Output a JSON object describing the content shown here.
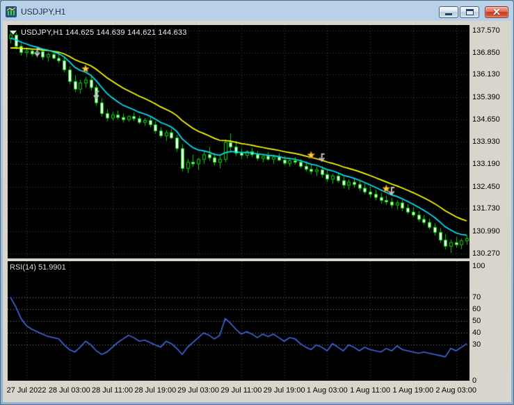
{
  "window": {
    "title": "USDJPY,H1"
  },
  "chart": {
    "info_line": "USDJPY,H1 144.625 144.639 144.621 144.633",
    "rsi_label": "RSI(14) 51.9901"
  },
  "chart_data": {
    "type": "candlestick",
    "title": "USDJPY,H1",
    "price_range": {
      "min": 130.1,
      "max": 137.75
    },
    "price_axis_labels": [
      {
        "text": "137.570",
        "value": 137.57
      },
      {
        "text": "136.850",
        "value": 136.85
      },
      {
        "text": "136.130",
        "value": 136.13
      },
      {
        "text": "135.390",
        "value": 135.39
      },
      {
        "text": "134.650",
        "value": 134.65
      },
      {
        "text": "133.930",
        "value": 133.93
      },
      {
        "text": "133.190",
        "value": 133.19
      },
      {
        "text": "132.450",
        "value": 132.45
      },
      {
        "text": "131.730",
        "value": 131.73
      },
      {
        "text": "130.990",
        "value": 130.99
      },
      {
        "text": "130.270",
        "value": 130.27
      }
    ],
    "time_labels": [
      {
        "text": "27 Jul 2022",
        "index": 3
      },
      {
        "text": "28 Jul 03:00",
        "index": 11
      },
      {
        "text": "28 Jul 11:00",
        "index": 19
      },
      {
        "text": "28 Jul 19:00",
        "index": 27
      },
      {
        "text": "29 Jul 03:00",
        "index": 35
      },
      {
        "text": "29 Jul 11:00",
        "index": 43
      },
      {
        "text": "29 Jul 19:00",
        "index": 51
      },
      {
        "text": "1 Aug 03:00",
        "index": 59
      },
      {
        "text": "1 Aug 11:00",
        "index": 67
      },
      {
        "text": "1 Aug 19:00",
        "index": 75
      },
      {
        "text": "2 Aug 03:00",
        "index": 83
      }
    ],
    "candles": [
      [
        137.3,
        137.57,
        137.15,
        137.42
      ],
      [
        137.42,
        137.5,
        136.95,
        137.05
      ],
      [
        137.05,
        137.15,
        136.75,
        136.85
      ],
      [
        136.85,
        137.0,
        136.7,
        136.9
      ],
      [
        136.9,
        136.98,
        136.72,
        136.8
      ],
      [
        136.8,
        136.92,
        136.68,
        136.88
      ],
      [
        136.88,
        136.95,
        136.6,
        136.7
      ],
      [
        136.7,
        136.85,
        136.55,
        136.78
      ],
      [
        136.78,
        136.88,
        136.62,
        136.66
      ],
      [
        136.66,
        136.8,
        136.5,
        136.58
      ],
      [
        136.58,
        136.7,
        136.2,
        136.28
      ],
      [
        136.28,
        136.4,
        135.8,
        135.9
      ],
      [
        135.9,
        136.1,
        135.55,
        135.65
      ],
      [
        135.65,
        135.95,
        135.5,
        135.85
      ],
      [
        135.85,
        136.05,
        135.7,
        135.95
      ],
      [
        135.95,
        136.1,
        135.6,
        135.7
      ],
      [
        135.7,
        135.8,
        135.1,
        135.2
      ],
      [
        135.2,
        135.35,
        134.75,
        134.85
      ],
      [
        134.85,
        135.0,
        134.6,
        134.7
      ],
      [
        134.7,
        134.9,
        134.62,
        134.8
      ],
      [
        134.8,
        134.95,
        134.65,
        134.72
      ],
      [
        134.72,
        134.85,
        134.55,
        134.65
      ],
      [
        134.65,
        134.8,
        134.58,
        134.75
      ],
      [
        134.75,
        134.88,
        134.6,
        134.68
      ],
      [
        134.68,
        134.78,
        134.5,
        134.56
      ],
      [
        134.56,
        134.7,
        134.45,
        134.62
      ],
      [
        134.62,
        134.72,
        134.4,
        134.48
      ],
      [
        134.48,
        134.6,
        134.2,
        134.28
      ],
      [
        134.28,
        134.4,
        134.05,
        134.12
      ],
      [
        134.12,
        134.3,
        133.95,
        134.22
      ],
      [
        134.22,
        134.35,
        134.0,
        134.05
      ],
      [
        134.05,
        134.15,
        133.6,
        133.7
      ],
      [
        133.7,
        133.85,
        132.95,
        133.05
      ],
      [
        133.05,
        133.35,
        132.9,
        133.25
      ],
      [
        133.25,
        133.5,
        133.1,
        133.2
      ],
      [
        133.2,
        133.4,
        133.0,
        133.35
      ],
      [
        133.35,
        133.6,
        133.2,
        133.5
      ],
      [
        133.5,
        133.75,
        133.3,
        133.4
      ],
      [
        133.4,
        133.55,
        133.15,
        133.25
      ],
      [
        133.25,
        133.45,
        133.05,
        133.35
      ],
      [
        133.35,
        134.0,
        133.25,
        133.9
      ],
      [
        133.9,
        134.2,
        133.6,
        133.75
      ],
      [
        133.75,
        133.95,
        133.45,
        133.55
      ],
      [
        133.55,
        133.7,
        133.35,
        133.48
      ],
      [
        133.48,
        133.65,
        133.38,
        133.6
      ],
      [
        133.6,
        133.72,
        133.42,
        133.5
      ],
      [
        133.5,
        133.62,
        133.3,
        133.38
      ],
      [
        133.38,
        133.52,
        133.25,
        133.45
      ],
      [
        133.45,
        133.58,
        133.3,
        133.35
      ],
      [
        133.35,
        133.5,
        133.2,
        133.42
      ],
      [
        133.42,
        133.55,
        133.28,
        133.32
      ],
      [
        133.32,
        133.45,
        133.15,
        133.22
      ],
      [
        133.22,
        133.38,
        133.1,
        133.3
      ],
      [
        133.3,
        133.42,
        133.18,
        133.25
      ],
      [
        133.25,
        133.35,
        133.05,
        133.12
      ],
      [
        133.12,
        133.28,
        132.95,
        133.02
      ],
      [
        133.02,
        133.18,
        132.85,
        132.95
      ],
      [
        132.95,
        133.1,
        132.8,
        133.0
      ],
      [
        133.0,
        133.12,
        132.75,
        132.85
      ],
      [
        132.85,
        132.98,
        132.6,
        132.7
      ],
      [
        132.7,
        132.88,
        132.55,
        132.8
      ],
      [
        132.8,
        132.92,
        132.58,
        132.65
      ],
      [
        132.65,
        132.78,
        132.4,
        132.5
      ],
      [
        132.5,
        132.68,
        132.35,
        132.6
      ],
      [
        132.6,
        132.72,
        132.42,
        132.52
      ],
      [
        132.52,
        132.65,
        132.3,
        132.4
      ],
      [
        132.4,
        132.55,
        132.2,
        132.28
      ],
      [
        132.28,
        132.45,
        132.1,
        132.2
      ],
      [
        132.2,
        132.35,
        132.0,
        132.1
      ],
      [
        132.1,
        132.25,
        131.9,
        132.0
      ],
      [
        132.0,
        132.15,
        131.85,
        131.95
      ],
      [
        131.95,
        132.08,
        131.75,
        131.85
      ],
      [
        131.85,
        132.0,
        131.7,
        131.92
      ],
      [
        131.92,
        132.02,
        131.65,
        131.75
      ],
      [
        131.75,
        131.88,
        131.55,
        131.62
      ],
      [
        131.62,
        131.78,
        131.45,
        131.52
      ],
      [
        131.52,
        131.65,
        131.3,
        131.38
      ],
      [
        131.38,
        131.52,
        131.2,
        131.28
      ],
      [
        131.28,
        131.4,
        131.05,
        131.12
      ],
      [
        131.12,
        131.25,
        130.85,
        130.95
      ],
      [
        130.95,
        131.1,
        130.6,
        130.7
      ],
      [
        130.7,
        130.9,
        130.4,
        130.5
      ],
      [
        130.5,
        130.72,
        130.28,
        130.62
      ],
      [
        130.62,
        130.8,
        130.45,
        130.55
      ],
      [
        130.55,
        130.75,
        130.4,
        130.68
      ],
      [
        130.68,
        130.85,
        130.55,
        130.75
      ]
    ],
    "indicators": {
      "ma_slow": {
        "period": 20,
        "seed": 136.95,
        "color": "#ffff00"
      },
      "ma_fast": {
        "period": 9,
        "seed": 137.3,
        "color": "#00e5ff"
      },
      "rsi": {
        "label": "RSI(14) 51.9901",
        "period": 14,
        "current": "51.9901",
        "color": "#4169e1",
        "levels": [
          30,
          40,
          50,
          60,
          70
        ],
        "axis_labels": [
          {
            "text": "100",
            "value": 100
          },
          {
            "text": "70",
            "value": 70
          },
          {
            "text": "60",
            "value": 60
          },
          {
            "text": "50",
            "value": 50
          },
          {
            "text": "40",
            "value": 40
          },
          {
            "text": "30",
            "value": 30
          },
          {
            "text": "0",
            "value": 0
          }
        ],
        "values": [
          70,
          62,
          52,
          46,
          43,
          41,
          39,
          37,
          36,
          35,
          30,
          26,
          24,
          28,
          33,
          30,
          25,
          22,
          24,
          28,
          32,
          35,
          38,
          36,
          33,
          34,
          32,
          30,
          28,
          33,
          31,
          27,
          22,
          28,
          32,
          36,
          40,
          38,
          35,
          38,
          52,
          48,
          43,
          39,
          41,
          39,
          36,
          39,
          37,
          39,
          36,
          33,
          36,
          35,
          31,
          28,
          26,
          30,
          28,
          25,
          31,
          28,
          25,
          30,
          28,
          25,
          28,
          26,
          25,
          24,
          27,
          25,
          29,
          26,
          25,
          24,
          23,
          24,
          23,
          22,
          21,
          20,
          27,
          25,
          28,
          31
        ]
      }
    },
    "markers": {
      "arrows": [
        {
          "index": 5,
          "price": 136.7
        },
        {
          "index": 16,
          "price": 135.3
        },
        {
          "index": 58,
          "price": 133.25
        },
        {
          "index": 71,
          "price": 132.15
        }
      ],
      "stars": [
        {
          "index": 14,
          "price": 136.15
        },
        {
          "index": 56,
          "price": 133.32
        },
        {
          "index": 70,
          "price": 132.22
        }
      ]
    },
    "colors": {
      "background": "#000000",
      "grid": "#2a522a",
      "candle_line": "#00d200",
      "candle_up_fill": "#000000",
      "candle_down_fill": "#f2fff2",
      "rsi_levels": "#8c8c8c",
      "arrow": "#c0c0c0",
      "star": "#ffd24a",
      "star_stroke": "#b8860b"
    }
  }
}
